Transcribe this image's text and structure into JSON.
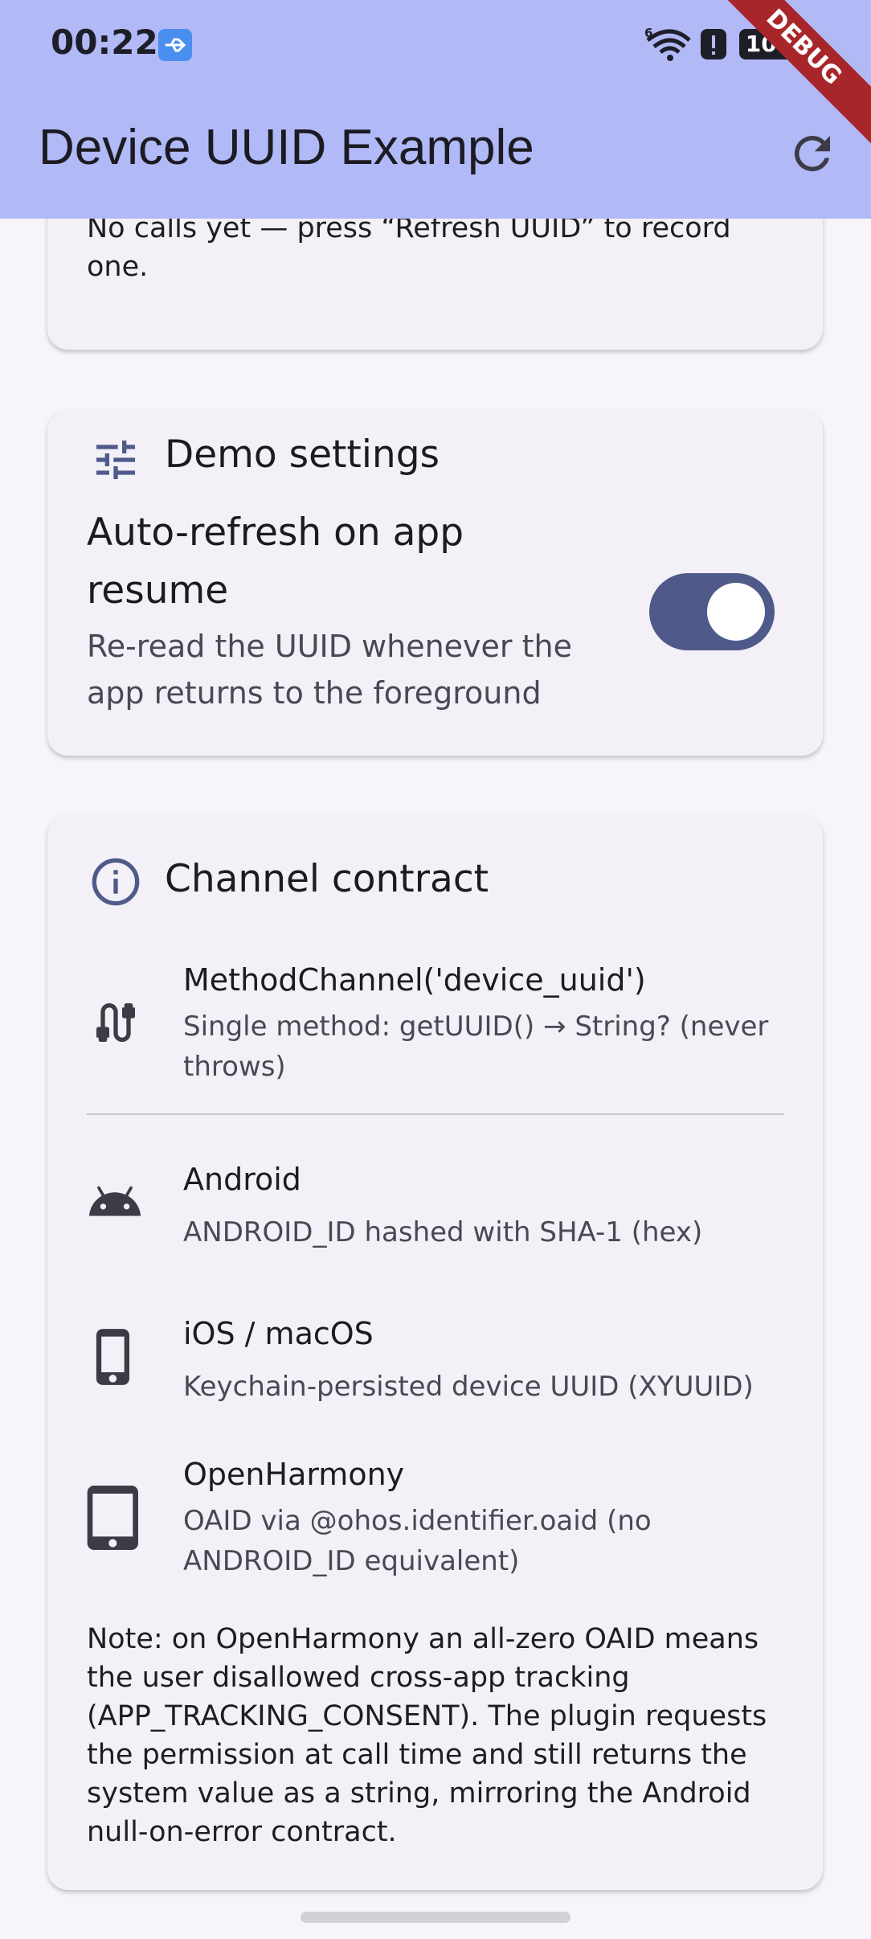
{
  "status_bar": {
    "time": "00:22",
    "battery": "100",
    "icons": [
      "usb-icon",
      "wifi-6-icon",
      "alert-icon",
      "battery-icon",
      "charging-icon"
    ]
  },
  "app_bar": {
    "title": "Device UUID Example",
    "refresh_icon": "refresh-icon",
    "background": "#b1b9f7"
  },
  "debug_banner": "DEBUG",
  "history_card": {
    "empty_text": "No calls yet — press “Refresh UUID” to record one."
  },
  "demo_settings": {
    "title": "Demo settings",
    "icon": "tune-icon",
    "toggle": {
      "label": "Auto-refresh on app resume",
      "description": "Re-read the UUID whenever the app returns to the foreground",
      "value": true,
      "active_color": "#4f5a8a"
    }
  },
  "channel_contract": {
    "title": "Channel contract",
    "icon": "info-icon",
    "rows": [
      {
        "icon": "cable-icon",
        "title": "MethodChannel('device_uuid')",
        "subtitle": "Single method: getUUID() → String? (never throws)"
      },
      {
        "icon": "android-icon",
        "title": "Android",
        "subtitle": "ANDROID_ID hashed with SHA-1 (hex)"
      },
      {
        "icon": "phone-icon",
        "title": "iOS / macOS",
        "subtitle": "Keychain-persisted device UUID (XYUUID)"
      },
      {
        "icon": "tablet-icon",
        "title": "OpenHarmony",
        "subtitle": "OAID via @ohos.identifier.oaid (no ANDROID_ID equivalent)"
      }
    ],
    "note": "Note: on OpenHarmony an all-zero OAID means the user disallowed cross-app tracking (APP_TRACKING_CONSENT). The plugin requests the permission at call time and still returns the system value as a string, mirroring the Android null-on-error contract."
  }
}
